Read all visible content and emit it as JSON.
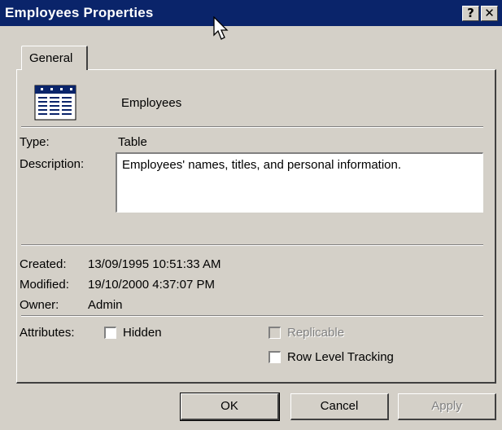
{
  "window": {
    "title": "Employees Properties"
  },
  "titlebar_buttons": {
    "help": "?",
    "close": "✕"
  },
  "tabs": [
    {
      "label": "General",
      "active": true
    }
  ],
  "object": {
    "name": "Employees",
    "icon": "table-icon"
  },
  "fields": {
    "type_label": "Type:",
    "type_value": "Table",
    "description_label": "Description:",
    "description_value": "Employees' names, titles, and personal information.",
    "created_label": "Created:",
    "created_value": "13/09/1995 10:51:33 AM",
    "modified_label": "Modified:",
    "modified_value": "19/10/2000 4:37:07 PM",
    "owner_label": "Owner:",
    "owner_value": "Admin"
  },
  "attributes": {
    "label": "Attributes:",
    "hidden": {
      "label": "Hidden",
      "checked": false
    },
    "replicable": {
      "label": "Replicable",
      "checked": false,
      "enabled": false
    },
    "row_level_tracking": {
      "label": "Row Level Tracking",
      "checked": false
    }
  },
  "buttons": {
    "ok": "OK",
    "cancel": "Cancel",
    "apply": "Apply"
  },
  "colors": {
    "titlebar": "#0a246a",
    "face": "#d4d0c8"
  }
}
